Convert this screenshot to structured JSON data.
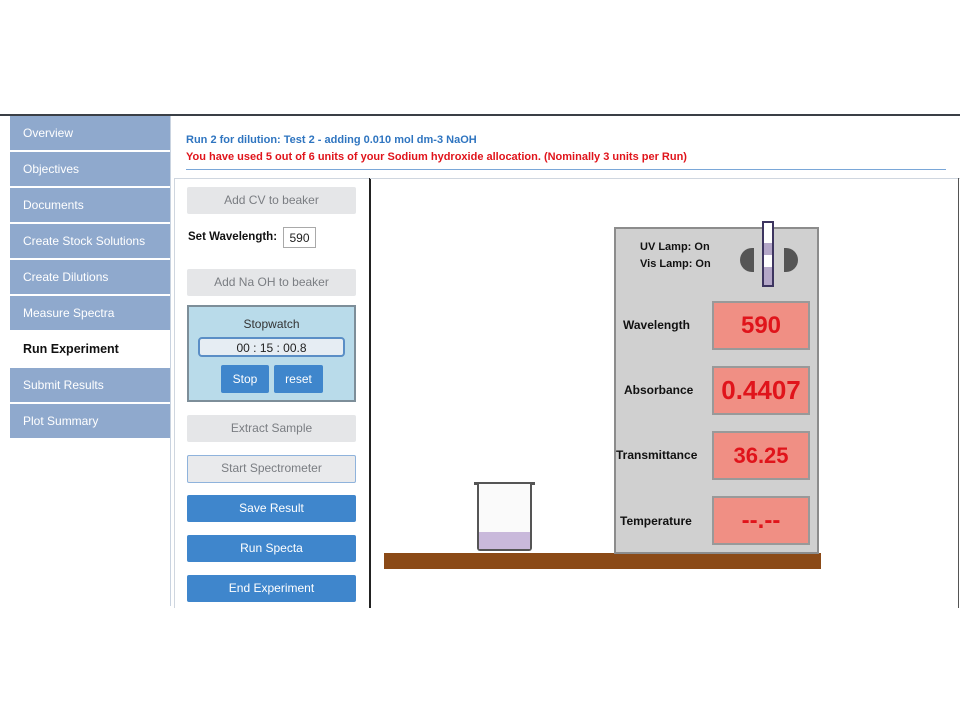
{
  "sidebar": {
    "items": [
      {
        "label": "Overview",
        "active": false
      },
      {
        "label": "Objectives",
        "active": false
      },
      {
        "label": "Documents",
        "active": false
      },
      {
        "label": "Create Stock Solutions",
        "active": false
      },
      {
        "label": "Create Dilutions",
        "active": false
      },
      {
        "label": "Measure Spectra",
        "active": false
      },
      {
        "label": "Run Experiment",
        "active": true
      },
      {
        "label": "Submit Results",
        "active": false
      },
      {
        "label": "Plot Summary",
        "active": false
      }
    ]
  },
  "header": {
    "run_info": "Run 2 for dilution: Test 2 - adding 0.010 mol dm-3 NaOH",
    "allocation_warning": "You have used 5 out of 6 units of your Sodium hydroxide allocation. (Nominally 3 units per Run)"
  },
  "controls": {
    "add_cv_label": "Add CV to beaker",
    "wavelength_label": "Set Wavelength:",
    "wavelength_value": "590",
    "add_naoh_label": "Add Na OH to beaker",
    "stopwatch": {
      "title": "Stopwatch",
      "time": "00 : 15 : 00.8",
      "stop_label": "Stop",
      "reset_label": "reset"
    },
    "extract_label": "Extract Sample",
    "start_spectrometer_label": "Start Spectrometer",
    "save_result_label": "Save Result",
    "run_spectra_label": "Run Specta",
    "end_experiment_label": "End Experiment"
  },
  "spectrometer": {
    "uv_lamp": "UV Lamp: On",
    "vis_lamp": "Vis Lamp: On",
    "wavelength_label": "Wavelength",
    "wavelength_value": "590",
    "absorbance_label": "Absorbance",
    "absorbance_value": "0.4407",
    "transmittance_label": "Transmittance",
    "transmittance_value": "36.25",
    "temperature_label": "Temperature",
    "temperature_value": "--.--"
  },
  "colors": {
    "nav_bg": "#8fa9cd",
    "button_blue": "#3f86cc",
    "warning_red": "#e0141b",
    "header_blue": "#2f75c0",
    "display_bg": "#f08f84",
    "bench": "#8b4a17",
    "solution": "#c9b9db"
  },
  "icons": {
    "lamp": "lamp-housing-icon",
    "cuvette": "cuvette-icon",
    "beaker": "beaker-icon"
  }
}
